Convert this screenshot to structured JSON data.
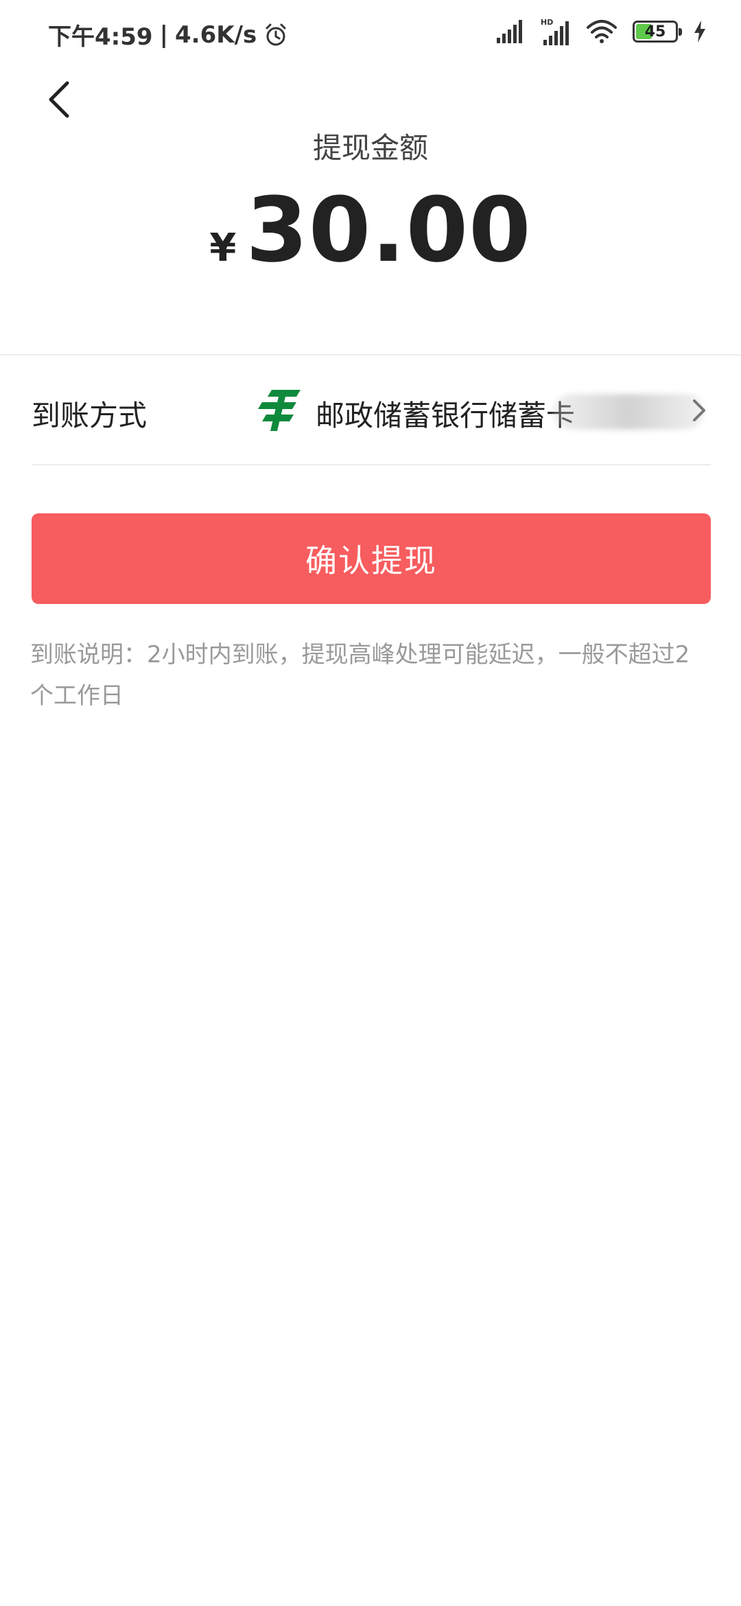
{
  "status_bar": {
    "time": "下午4:59",
    "separator": "|",
    "network_speed": "4.6K/s",
    "hd_label": "HD",
    "battery_level": "45",
    "battery_percent": 45
  },
  "header": {
    "title": "提现金额"
  },
  "amount": {
    "currency_symbol": "¥",
    "value": "30.00"
  },
  "payout_method": {
    "label": "到账方式",
    "bank_name": "邮政储蓄银行储蓄卡"
  },
  "confirm_button": {
    "label": "确认提现"
  },
  "note": {
    "text": "到账说明：2小时内到账，提现高峰处理可能延迟，一般不超过2个工作日"
  },
  "colors": {
    "primary_button": "#f75c5e",
    "bank_logo": "#0f8a3c",
    "note_text": "#9a9a9a",
    "battery_fill": "#5ec94a"
  }
}
